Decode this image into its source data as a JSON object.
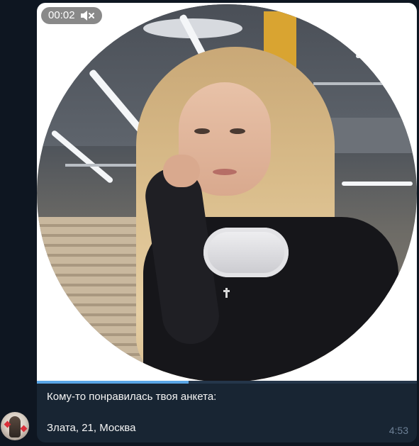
{
  "message": {
    "video_timer": "00:02",
    "mute_icon": "speaker-muted-icon",
    "progress": 0.4,
    "caption_line1": "Кому-то понравилась твоя анкета:",
    "caption_line2": "Злата, 21, Москва",
    "time": "4:53"
  },
  "colors": {
    "chat_background": "#0e1621",
    "bubble": "#182533",
    "progress": "#5aa6e6",
    "time_text": "#6d8096"
  }
}
